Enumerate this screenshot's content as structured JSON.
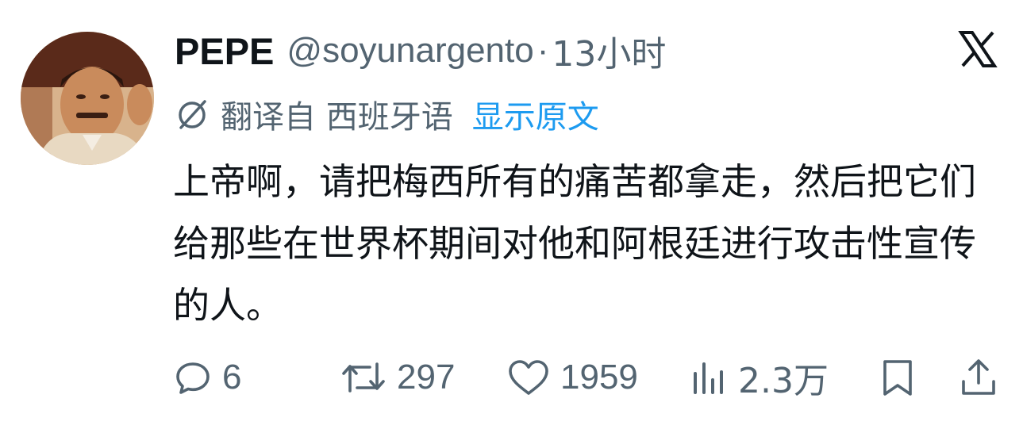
{
  "author": {
    "display_name": "PEPE",
    "handle": "@soyunargento",
    "separator": "·",
    "time": "13小时"
  },
  "platform_logo": "x-logo",
  "translation": {
    "icon": "globe-slash-icon",
    "label": "翻译自 西班牙语",
    "show_original": "显示原文"
  },
  "tweet": {
    "text": "上帝啊，请把梅西所有的痛苦都拿走，然后把它们给那些在世界杯期间对他和阿根廷进行攻击性宣传的人。"
  },
  "actions": {
    "reply_count": "6",
    "retweet_count": "297",
    "like_count": "1959",
    "views_count": "2.3万"
  },
  "colors": {
    "text_primary": "#0f1419",
    "text_secondary": "#536471",
    "accent": "#1d9bf0"
  }
}
